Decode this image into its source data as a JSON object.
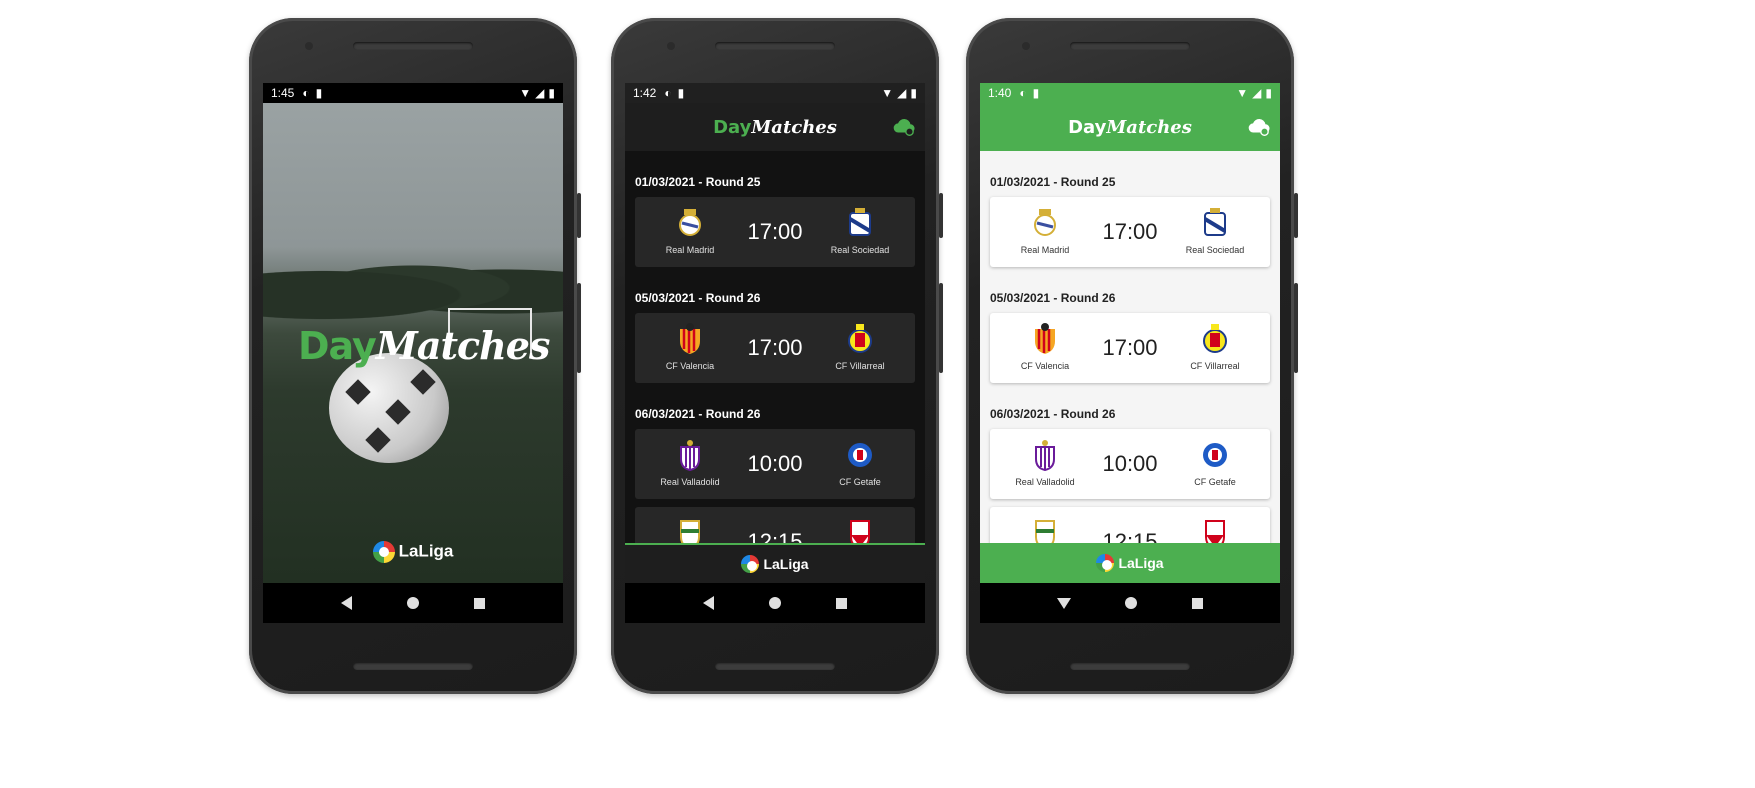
{
  "phones": [
    {
      "status_time": "1:45",
      "brand_day": "Day",
      "brand_matches": "Matches",
      "sponsor": "LaLiga"
    },
    {
      "status_time": "1:42",
      "brand_day": "Day",
      "brand_matches": "Matches",
      "sponsor": "LaLiga"
    },
    {
      "status_time": "1:40",
      "brand_day": "Day",
      "brand_matches": "Matches",
      "sponsor": "LaLiga"
    }
  ],
  "rounds": [
    {
      "title": "01/03/2021 - Round 25",
      "home": "Real Madrid",
      "time": "17:00",
      "away": "Real Sociedad"
    },
    {
      "title": "05/03/2021 - Round 26",
      "home": "CF Valencia",
      "time": "17:00",
      "away": "CF Villarreal"
    },
    {
      "title": "06/03/2021 - Round 26",
      "home": "Real Valladolid",
      "time": "10:00",
      "away": "CF Getafe"
    },
    {
      "title": "",
      "home": "",
      "time": "12:15",
      "away": ""
    }
  ],
  "colors": {
    "accent": "#4caf50",
    "dark_bg": "#121212",
    "dark_card": "#272727",
    "light_bg": "#f5f5f5"
  },
  "icons": {
    "sync": "cloud-sync-icon",
    "wifi": "wifi-icon",
    "signal": "signal-icon",
    "battery": "battery-icon"
  }
}
